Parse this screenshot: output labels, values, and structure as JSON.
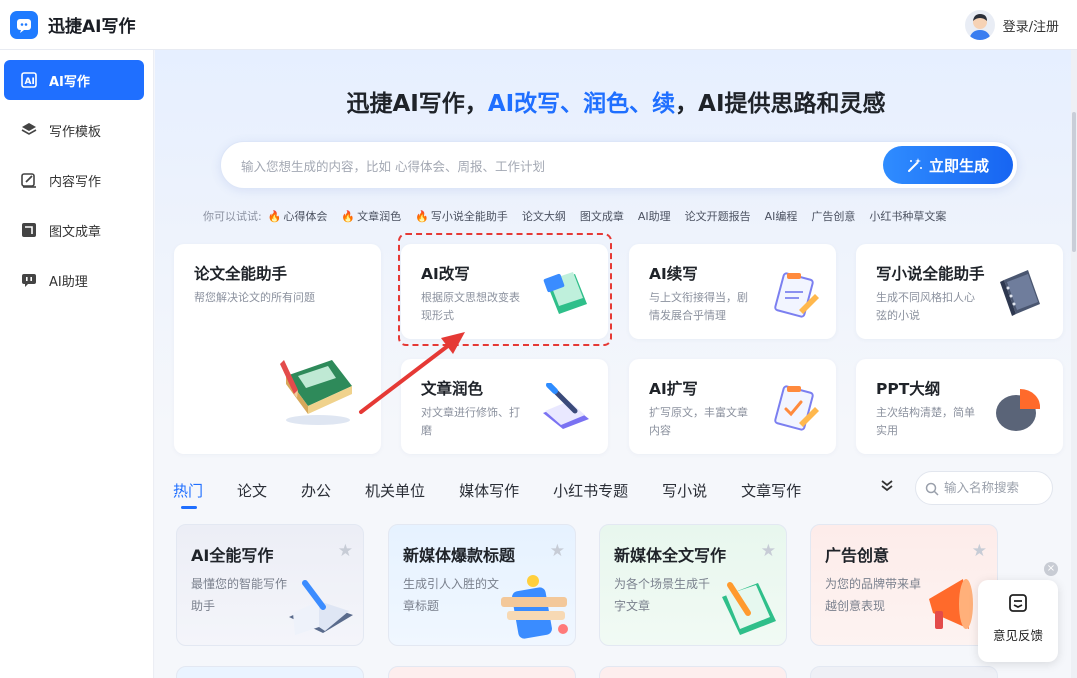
{
  "app": {
    "title": "迅捷AI写作",
    "login_label": "登录/注册"
  },
  "sidebar": {
    "items": [
      {
        "label": "AI写作",
        "icon": "ai-write-icon",
        "active": true
      },
      {
        "label": "写作模板",
        "icon": "template-icon"
      },
      {
        "label": "内容写作",
        "icon": "content-write-icon"
      },
      {
        "label": "图文成章",
        "icon": "image-text-icon"
      },
      {
        "label": "AI助理",
        "icon": "assistant-icon"
      }
    ]
  },
  "hero": {
    "part1": "迅捷AI写作，",
    "highlight": "AI改写、润色、续",
    "part2": "，AI提供思路和灵感"
  },
  "search": {
    "placeholder": "输入您想生成的内容，比如 心得体会、周报、工作计划",
    "button_label": "立即生成"
  },
  "try_bar": {
    "lead": "你可以试试:",
    "items": [
      {
        "label": "心得体会",
        "hot": true
      },
      {
        "label": "文章润色",
        "hot": true
      },
      {
        "label": "写小说全能助手",
        "hot": true
      },
      {
        "label": "论文大纲"
      },
      {
        "label": "图文成章"
      },
      {
        "label": "AI助理"
      },
      {
        "label": "论文开题报告"
      },
      {
        "label": "AI编程"
      },
      {
        "label": "广告创意"
      },
      {
        "label": "小红书种草文案"
      }
    ]
  },
  "features": {
    "big": {
      "title": "论文全能助手",
      "desc": "帮您解决论文的所有问题"
    },
    "cards": [
      {
        "title": "AI改写",
        "desc": "根据原文思想改变表现形式"
      },
      {
        "title": "AI续写",
        "desc": "与上文衔接得当，剧情发展合乎情理"
      },
      {
        "title": "写小说全能助手",
        "desc": "生成不同风格扣人心弦的小说"
      },
      {
        "title": "文章润色",
        "desc": "对文章进行修饰、打磨"
      },
      {
        "title": "AI扩写",
        "desc": "扩写原文，丰富文章内容"
      },
      {
        "title": "PPT大纲",
        "desc": "主次结构清楚，简单实用"
      }
    ]
  },
  "category_tabs": [
    "热门",
    "论文",
    "办公",
    "机关单位",
    "媒体写作",
    "小红书专题",
    "写小说",
    "文章写作"
  ],
  "category_search_placeholder": "输入名称搜索",
  "templates": [
    {
      "title": "AI全能写作",
      "desc": "最懂您的智能写作助手"
    },
    {
      "title": "新媒体爆款标题",
      "desc": "生成引人入胜的文章标题"
    },
    {
      "title": "新媒体全文写作",
      "desc": "为各个场景生成千字文章"
    },
    {
      "title": "广告创意",
      "desc": "为您的品牌带来卓越创意表现"
    }
  ],
  "feedback_label": "意见反馈",
  "colors": {
    "accent": "#1f6fff",
    "highlight_box": "#e53935",
    "arrow": "#e53935"
  }
}
